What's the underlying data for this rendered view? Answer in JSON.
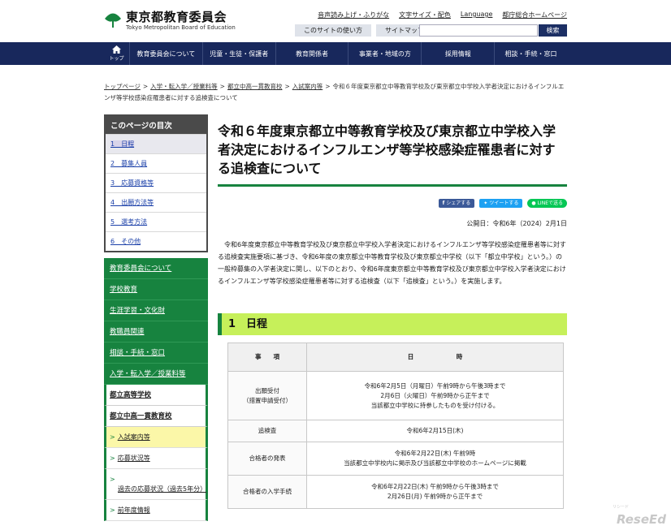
{
  "header": {
    "logo_ja": "東京都教育委員会",
    "logo_en": "Tokyo Metropolitan Board of Education",
    "util_links": [
      "音声読み上げ・ふりがな",
      "文字サイズ・配色",
      "Language",
      "都庁総合ホームページ"
    ],
    "sub_buttons": [
      "このサイトの使い方",
      "サイトマップ"
    ],
    "search_label": "検索",
    "brand_color": "#18285c"
  },
  "gnav": {
    "home_label": "トップ",
    "items": [
      "教育委員会について",
      "児童・生徒・保護者",
      "教育関係者",
      "事業者・地域の方",
      "採用情報",
      "相談・手続・窓口"
    ]
  },
  "breadcrumb": {
    "items": [
      "トップページ",
      "入学・転入学／授業料等",
      "都立中高一貫教育校",
      "入試案内等"
    ],
    "current": "令和６年度東京都立中等教育学校及び東京都立中学校入学者決定におけるインフルエンザ等学校感染症罹患者に対する追検査について"
  },
  "toc": {
    "title": "このページの目次",
    "items": [
      "1　日程",
      "2　募集人員",
      "3　応募資格等",
      "4　出願方法等",
      "5　選考方法",
      "6　その他"
    ]
  },
  "side_nav": {
    "items": [
      "教育委員会について",
      "学校教育",
      "生涯学習・文化財",
      "教職員関連",
      "相談・手続・窓口",
      "入学・転入学／授業料等",
      "都立高等学校",
      "都立中高一貫教育校"
    ],
    "sub_items": [
      "入試案内等",
      "応募状況等",
      "過去の応募状況（過去5年分）",
      "前年度情報"
    ],
    "accent": "#17833f"
  },
  "main": {
    "title": "令和６年度東京都立中等教育学校及び東京都立中学校入学者決定におけるインフルエンザ等学校感染症罹患者に対する追検査について",
    "share": [
      "シェアする",
      "ツイートする",
      "LINEで送る"
    ],
    "pub_date": "公開日：令和6年（2024）2月1日",
    "intro": "令和6年度東京都立中等教育学校及び東京都立中学校入学者決定におけるインフルエンザ等学校感染症罹患者等に対する追検査実施要項に基づき、令和6年度の東京都立中等教育学校及び東京都立中学校（以下「都立中学校」という。）の一般枠募集の入学者決定に関し、以下のとおり、令和6年度東京都立中等教育学校及び東京都立中学校入学者決定におけるインフルエンザ等学校感染症罹患者等に対する追検査（以下「追検査」という。）を実施します。",
    "section1": "1　日程",
    "section_color": "#c6f05a"
  },
  "schedule": {
    "headers": [
      "事　　項",
      "日　　　　　　　時"
    ],
    "rows": [
      {
        "label": [
          "出願受付",
          "（措置申請受付）"
        ],
        "value": [
          "令和6年2月5日（月曜日）午前9時から午後3時まで",
          "2月6日（火曜日）午前9時から正午まで",
          "当該都立中学校に持参したものを受け付ける。"
        ]
      },
      {
        "label": [
          "追検査"
        ],
        "value": [
          "令和6年2月15日(木)"
        ]
      },
      {
        "label": [
          "合格者の発表"
        ],
        "value": [
          "令和6年2月22日(木) 午前9時",
          "当該都立中学校内に掲示及び当該都立中学校のホームページに掲載"
        ]
      },
      {
        "label": [
          "合格者の入学手続"
        ],
        "value": [
          "令和6年2月22日(木) 午前9時から午後3時まで",
          "2月26日(月) 午前9時から正午まで"
        ]
      }
    ]
  },
  "watermark": {
    "text": "ReseEd",
    "sub": "リシード"
  }
}
